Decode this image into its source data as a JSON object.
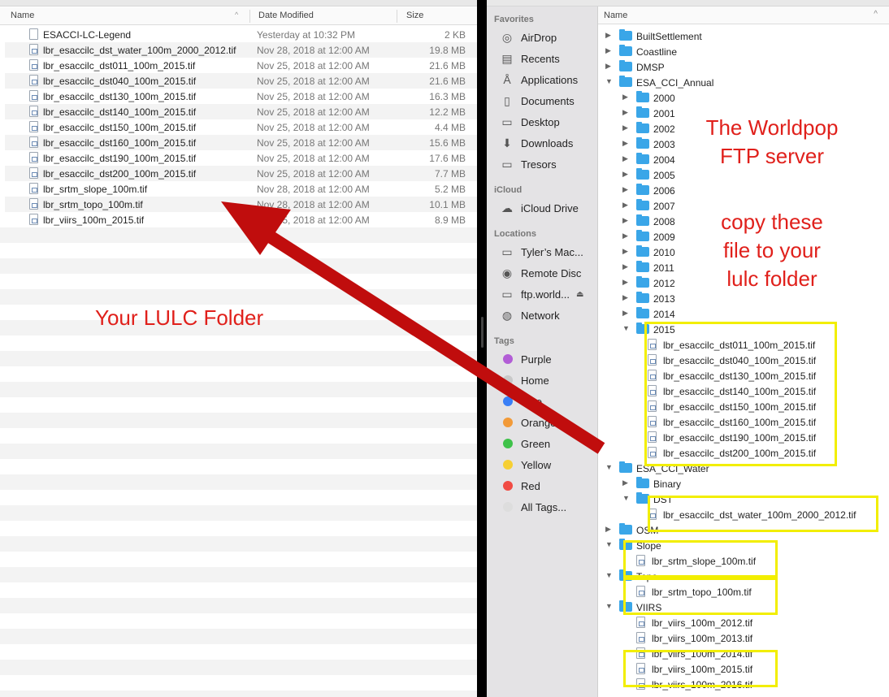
{
  "left_window": {
    "columns": {
      "name": "Name",
      "date": "Date Modified",
      "size": "Size"
    },
    "files": [
      {
        "name": "ESACCI-LC-Legend",
        "date": "Yesterday at 10:32 PM",
        "size": "2 KB",
        "icon": "document-icon"
      },
      {
        "name": "lbr_esaccilc_dst_water_100m_2000_2012.tif",
        "date": "Nov 28, 2018 at 12:00 AM",
        "size": "19.8 MB",
        "icon": "tif-file-icon"
      },
      {
        "name": "lbr_esaccilc_dst011_100m_2015.tif",
        "date": "Nov 25, 2018 at 12:00 AM",
        "size": "21.6 MB",
        "icon": "tif-file-icon"
      },
      {
        "name": "lbr_esaccilc_dst040_100m_2015.tif",
        "date": "Nov 25, 2018 at 12:00 AM",
        "size": "21.6 MB",
        "icon": "tif-file-icon"
      },
      {
        "name": "lbr_esaccilc_dst130_100m_2015.tif",
        "date": "Nov 25, 2018 at 12:00 AM",
        "size": "16.3 MB",
        "icon": "tif-file-icon"
      },
      {
        "name": "lbr_esaccilc_dst140_100m_2015.tif",
        "date": "Nov 25, 2018 at 12:00 AM",
        "size": "12.2 MB",
        "icon": "tif-file-icon"
      },
      {
        "name": "lbr_esaccilc_dst150_100m_2015.tif",
        "date": "Nov 25, 2018 at 12:00 AM",
        "size": "4.4 MB",
        "icon": "tif-file-icon"
      },
      {
        "name": "lbr_esaccilc_dst160_100m_2015.tif",
        "date": "Nov 25, 2018 at 12:00 AM",
        "size": "15.6 MB",
        "icon": "tif-file-icon"
      },
      {
        "name": "lbr_esaccilc_dst190_100m_2015.tif",
        "date": "Nov 25, 2018 at 12:00 AM",
        "size": "17.6 MB",
        "icon": "tif-file-icon"
      },
      {
        "name": "lbr_esaccilc_dst200_100m_2015.tif",
        "date": "Nov 25, 2018 at 12:00 AM",
        "size": "7.7 MB",
        "icon": "tif-file-icon"
      },
      {
        "name": "lbr_srtm_slope_100m.tif",
        "date": "Nov 28, 2018 at 12:00 AM",
        "size": "5.2 MB",
        "icon": "tif-file-icon"
      },
      {
        "name": "lbr_srtm_topo_100m.tif",
        "date": "Nov 28, 2018 at 12:00 AM",
        "size": "10.1 MB",
        "icon": "tif-file-icon"
      },
      {
        "name": "lbr_viirs_100m_2015.tif",
        "date": "Nov 25, 2018 at 12:00 AM",
        "size": "8.9 MB",
        "icon": "tif-file-icon"
      }
    ]
  },
  "sidebar": {
    "favorites_header": "Favorites",
    "favorites": [
      {
        "label": "AirDrop",
        "icon": "airdrop-icon"
      },
      {
        "label": "Recents",
        "icon": "recents-icon"
      },
      {
        "label": "Applications",
        "icon": "applications-icon"
      },
      {
        "label": "Documents",
        "icon": "documents-icon"
      },
      {
        "label": "Desktop",
        "icon": "desktop-icon"
      },
      {
        "label": "Downloads",
        "icon": "downloads-icon"
      },
      {
        "label": "Tresors",
        "icon": "folder-icon"
      }
    ],
    "icloud_header": "iCloud",
    "icloud": [
      {
        "label": "iCloud Drive",
        "icon": "cloud-icon"
      }
    ],
    "locations_header": "Locations",
    "locations": [
      {
        "label": "Tyler’s Mac...",
        "icon": "computer-icon"
      },
      {
        "label": "Remote Disc",
        "icon": "disc-icon"
      },
      {
        "label": "ftp.world...",
        "icon": "server-icon"
      },
      {
        "label": "Network",
        "icon": "network-icon"
      }
    ],
    "tags_header": "Tags",
    "tags": [
      {
        "label": "Purple",
        "color": "#b25dd6"
      },
      {
        "label": "Home",
        "color": "#c9c9c9"
      },
      {
        "label": "Blue",
        "color": "#3a7ff6"
      },
      {
        "label": "Orange",
        "color": "#f29a38"
      },
      {
        "label": "Green",
        "color": "#3fc24a"
      },
      {
        "label": "Yellow",
        "color": "#f6cf33"
      },
      {
        "label": "Red",
        "color": "#f14b43"
      },
      {
        "label": "All Tags...",
        "color": "#dddddd"
      }
    ]
  },
  "tree": {
    "header": "Name",
    "rows": [
      {
        "label": "BuiltSettlement",
        "kind": "folder",
        "level": 0,
        "disclosure": "collapsed"
      },
      {
        "label": "Coastline",
        "kind": "folder",
        "level": 0,
        "disclosure": "collapsed"
      },
      {
        "label": "DMSP",
        "kind": "folder",
        "level": 0,
        "disclosure": "collapsed"
      },
      {
        "label": "ESA_CCI_Annual",
        "kind": "folder",
        "level": 0,
        "disclosure": "expanded"
      },
      {
        "label": "2000",
        "kind": "folder",
        "level": 1,
        "disclosure": "collapsed"
      },
      {
        "label": "2001",
        "kind": "folder",
        "level": 1,
        "disclosure": "collapsed"
      },
      {
        "label": "2002",
        "kind": "folder",
        "level": 1,
        "disclosure": "collapsed"
      },
      {
        "label": "2003",
        "kind": "folder",
        "level": 1,
        "disclosure": "collapsed"
      },
      {
        "label": "2004",
        "kind": "folder",
        "level": 1,
        "disclosure": "collapsed"
      },
      {
        "label": "2005",
        "kind": "folder",
        "level": 1,
        "disclosure": "collapsed"
      },
      {
        "label": "2006",
        "kind": "folder",
        "level": 1,
        "disclosure": "collapsed"
      },
      {
        "label": "2007",
        "kind": "folder",
        "level": 1,
        "disclosure": "collapsed"
      },
      {
        "label": "2008",
        "kind": "folder",
        "level": 1,
        "disclosure": "collapsed"
      },
      {
        "label": "2009",
        "kind": "folder",
        "level": 1,
        "disclosure": "collapsed"
      },
      {
        "label": "2010",
        "kind": "folder",
        "level": 1,
        "disclosure": "collapsed"
      },
      {
        "label": "2011",
        "kind": "folder",
        "level": 1,
        "disclosure": "collapsed"
      },
      {
        "label": "2012",
        "kind": "folder",
        "level": 1,
        "disclosure": "collapsed"
      },
      {
        "label": "2013",
        "kind": "folder",
        "level": 1,
        "disclosure": "collapsed"
      },
      {
        "label": "2014",
        "kind": "folder",
        "level": 1,
        "disclosure": "collapsed"
      },
      {
        "label": "2015",
        "kind": "folder",
        "level": 1,
        "disclosure": "expanded"
      },
      {
        "label": "lbr_esaccilc_dst011_100m_2015.tif",
        "kind": "file",
        "level": 2
      },
      {
        "label": "lbr_esaccilc_dst040_100m_2015.tif",
        "kind": "file",
        "level": 2
      },
      {
        "label": "lbr_esaccilc_dst130_100m_2015.tif",
        "kind": "file",
        "level": 2
      },
      {
        "label": "lbr_esaccilc_dst140_100m_2015.tif",
        "kind": "file",
        "level": 2
      },
      {
        "label": "lbr_esaccilc_dst150_100m_2015.tif",
        "kind": "file",
        "level": 2
      },
      {
        "label": "lbr_esaccilc_dst160_100m_2015.tif",
        "kind": "file",
        "level": 2
      },
      {
        "label": "lbr_esaccilc_dst190_100m_2015.tif",
        "kind": "file",
        "level": 2
      },
      {
        "label": "lbr_esaccilc_dst200_100m_2015.tif",
        "kind": "file",
        "level": 2
      },
      {
        "label": "ESA_CCI_Water",
        "kind": "folder",
        "level": 0,
        "disclosure": "expanded"
      },
      {
        "label": "Binary",
        "kind": "folder",
        "level": 1,
        "disclosure": "collapsed"
      },
      {
        "label": "DST",
        "kind": "folder",
        "level": 1,
        "disclosure": "expanded"
      },
      {
        "label": "lbr_esaccilc_dst_water_100m_2000_2012.tif",
        "kind": "file",
        "level": 2
      },
      {
        "label": "OSM",
        "kind": "folder",
        "level": 0,
        "disclosure": "collapsed"
      },
      {
        "label": "Slope",
        "kind": "folder",
        "level": 0,
        "disclosure": "expanded"
      },
      {
        "label": "lbr_srtm_slope_100m.tif",
        "kind": "file",
        "level": 1
      },
      {
        "label": "Topo",
        "kind": "folder",
        "level": 0,
        "disclosure": "expanded"
      },
      {
        "label": "lbr_srtm_topo_100m.tif",
        "kind": "file",
        "level": 1
      },
      {
        "label": "VIIRS",
        "kind": "folder",
        "level": 0,
        "disclosure": "expanded"
      },
      {
        "label": "lbr_viirs_100m_2012.tif",
        "kind": "file",
        "level": 1
      },
      {
        "label": "lbr_viirs_100m_2013.tif",
        "kind": "file",
        "level": 1
      },
      {
        "label": "lbr_viirs_100m_2014.tif",
        "kind": "file",
        "level": 1
      },
      {
        "label": "lbr_viirs_100m_2015.tif",
        "kind": "file",
        "level": 1
      },
      {
        "label": "lbr_viirs_100m_2016.tif",
        "kind": "file",
        "level": 1
      }
    ]
  },
  "annotations": {
    "left_label": "Your LULC Folder",
    "right_title_line1": "The Worldpop",
    "right_title_line2": "FTP server",
    "instruction_line1": "copy these",
    "instruction_line2": "file to your",
    "instruction_line3": "lulc folder",
    "arrow_color": "#c00d0d",
    "text_color": "#e0201b",
    "highlight_color": "#f2ee00"
  }
}
